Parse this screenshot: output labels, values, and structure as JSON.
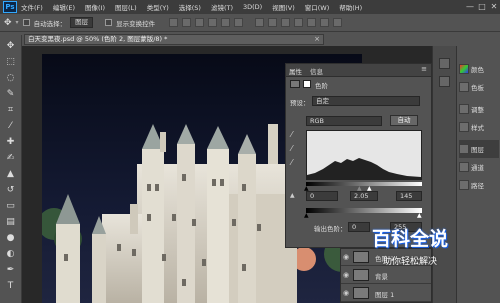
{
  "app": {
    "logo": "Ps"
  },
  "menu": [
    "文件(F)",
    "编辑(E)",
    "图像(I)",
    "图层(L)",
    "类型(Y)",
    "选择(S)",
    "滤镜(T)",
    "3D(D)",
    "视图(V)",
    "窗口(W)",
    "帮助(H)"
  ],
  "window_controls": {
    "minimize": "—",
    "maximize": "□",
    "close": "✕"
  },
  "options_bar": {
    "auto_select_label": "自动选择：",
    "auto_select_value": "图层",
    "show_transform_label": "显示变换控件"
  },
  "document": {
    "tab_title": "白天变黑夜.psd @ 50% (色阶 2, 图层蒙版/8) *",
    "close": "×"
  },
  "properties": {
    "tab_properties": "属性",
    "tab_info": "信息",
    "panel_icon": "levels-icon",
    "panel_title": "色阶",
    "preset_label": "预设：",
    "preset_value": "自定",
    "channel_value": "RGB",
    "auto_button": "自动",
    "input_black": "0",
    "input_gamma": "2.05",
    "input_white": "145",
    "output_label": "输出色阶：",
    "output_black": "0",
    "output_white": "255"
  },
  "right_panel": {
    "items": [
      {
        "icon": "color-icon",
        "label": "颜色"
      },
      {
        "icon": "swatches-icon",
        "label": "色板"
      },
      {
        "icon": "adjustments-icon",
        "label": "调整"
      },
      {
        "icon": "styles-icon",
        "label": "样式"
      },
      {
        "icon": "layers-icon",
        "label": "图层"
      },
      {
        "icon": "channels-icon",
        "label": "通道"
      },
      {
        "icon": "paths-icon",
        "label": "路径"
      }
    ]
  },
  "layers": {
    "rows": [
      {
        "name": "色阶 2"
      },
      {
        "name": "背景"
      },
      {
        "name": "图层 1"
      }
    ]
  },
  "watermark": {
    "title": "百科全说",
    "subtitle": "助你轻松解决"
  },
  "colors": {
    "accent": "#31a8ff",
    "menubar": "#3c3c3c",
    "panel": "#535353",
    "canvas_bg": "#282828"
  }
}
